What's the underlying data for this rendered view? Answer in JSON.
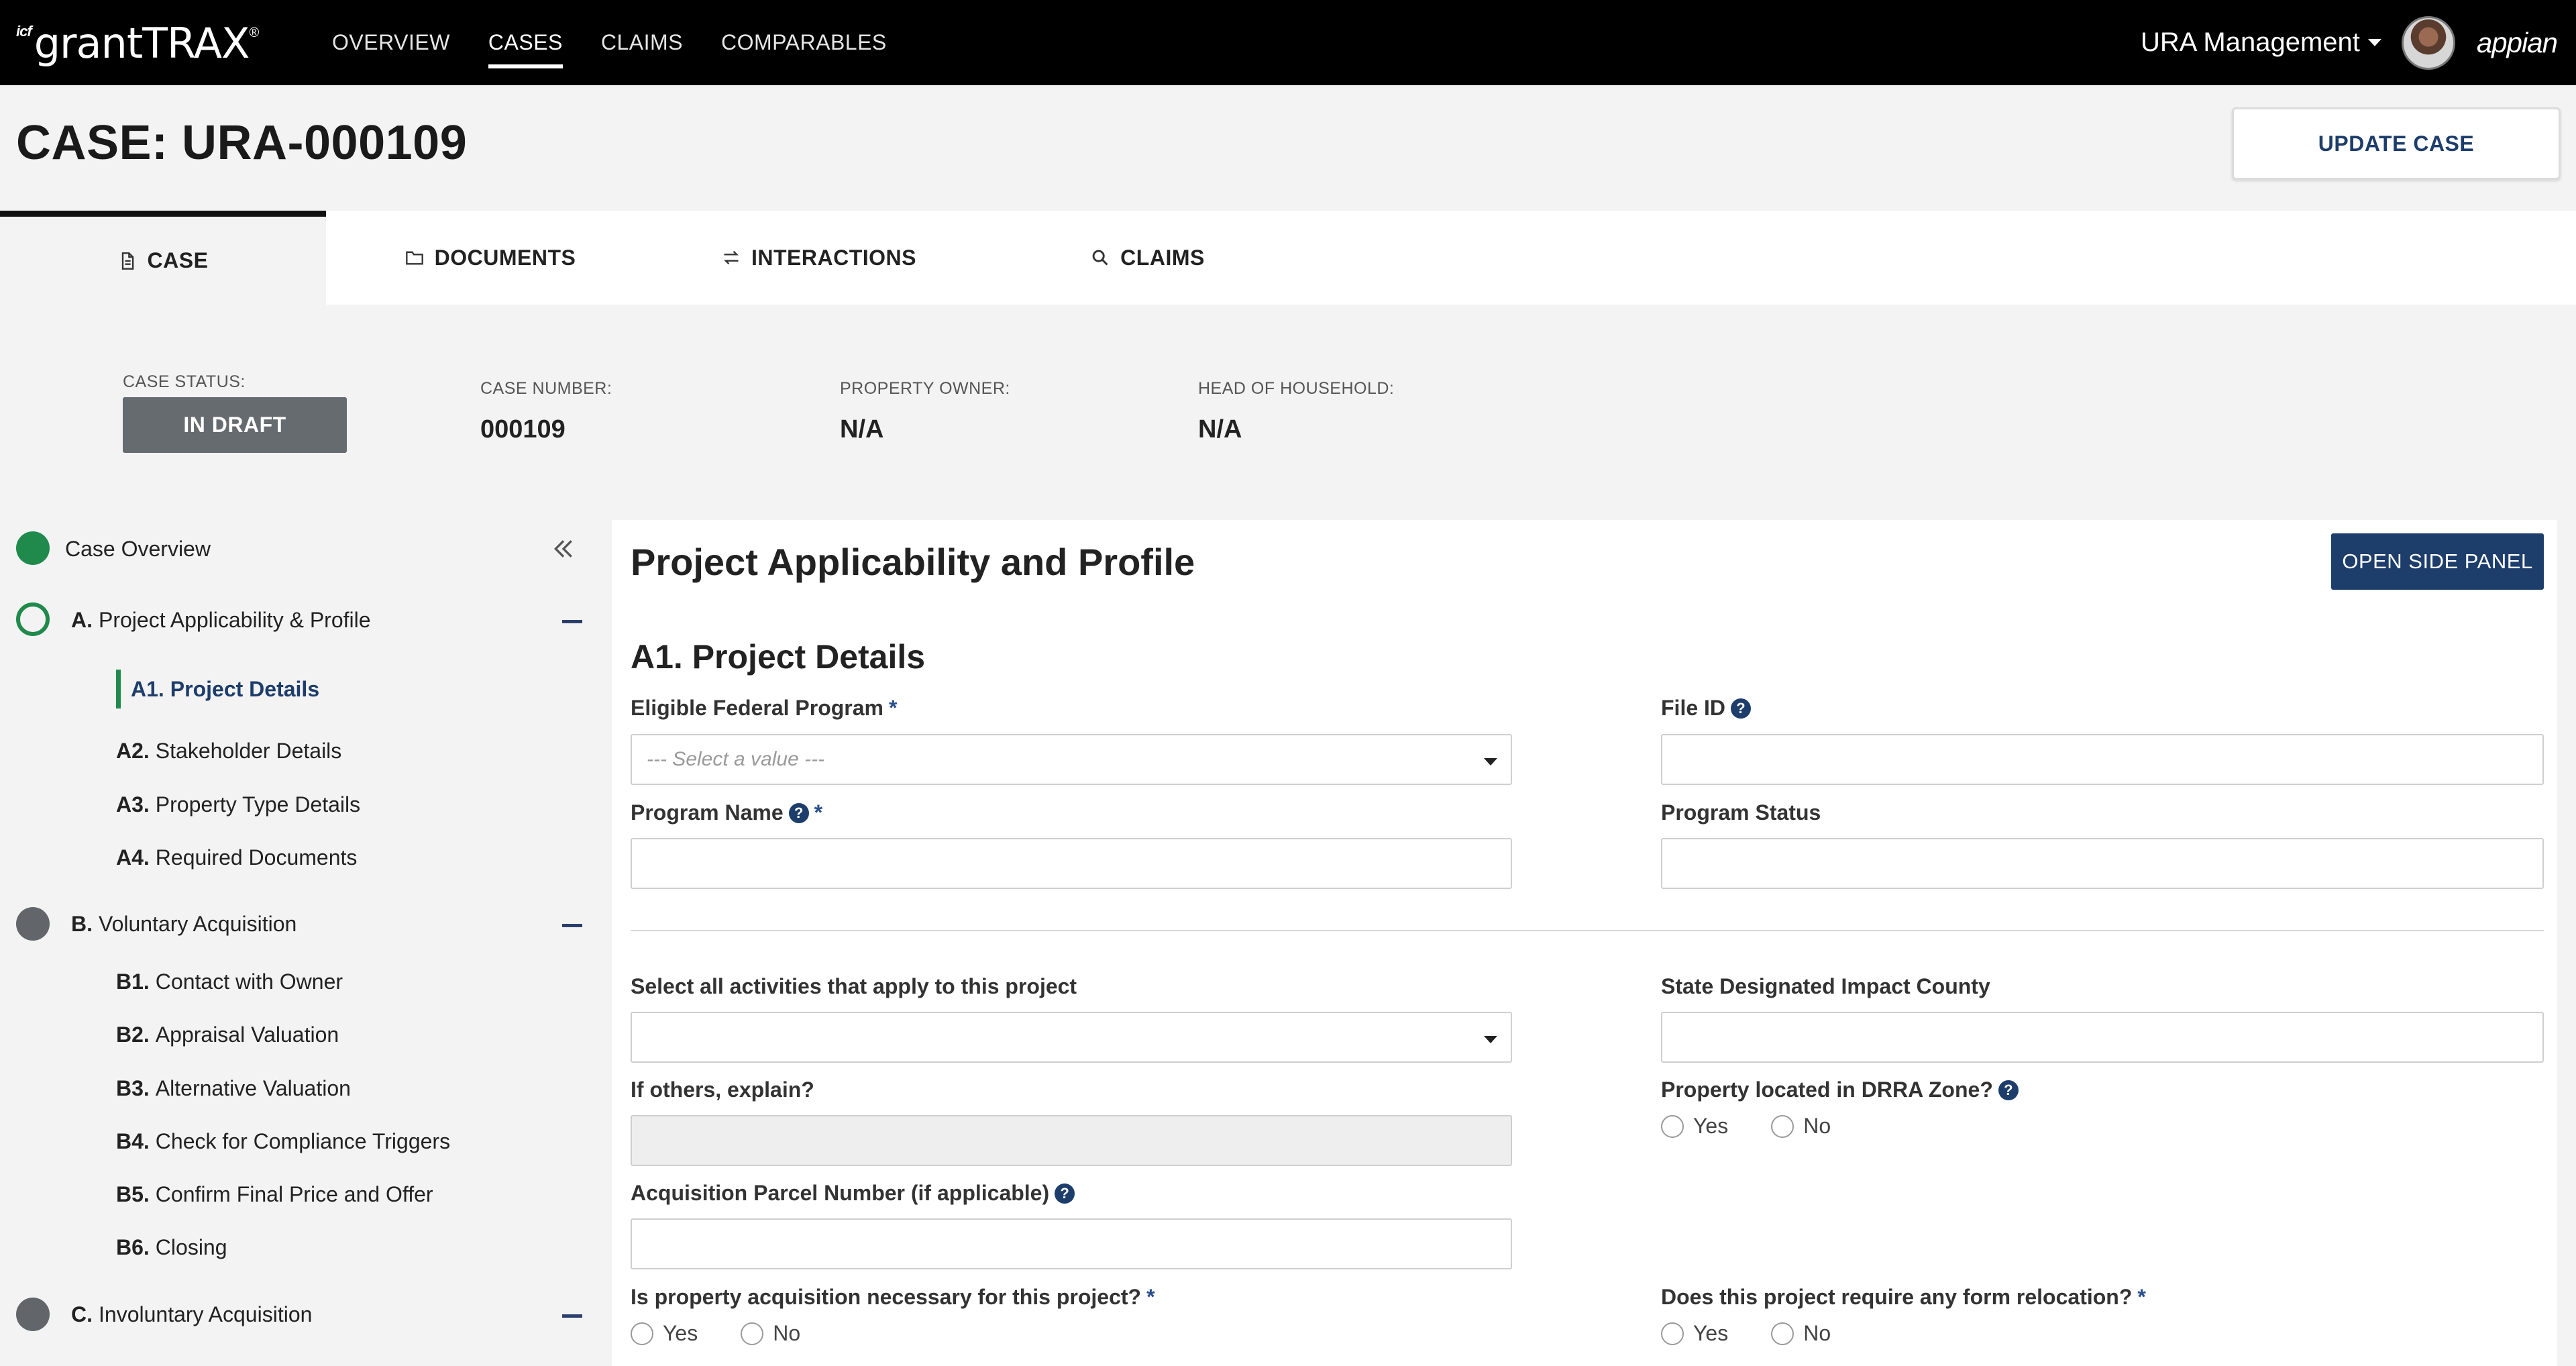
{
  "topbar": {
    "brand_prefix": "icf",
    "brand": "grantTRAX",
    "trademark": "®",
    "nav": [
      "OVERVIEW",
      "CASES",
      "CLAIMS",
      "COMPARABLES"
    ],
    "active_nav": "CASES",
    "user_menu": "URA Management",
    "platform": "appian"
  },
  "case": {
    "title": "CASE: URA-000109",
    "update_button": "UPDATE CASE"
  },
  "tabs": [
    {
      "label": "CASE",
      "icon": "document-icon"
    },
    {
      "label": "DOCUMENTS",
      "icon": "folder-icon"
    },
    {
      "label": "INTERACTIONS",
      "icon": "arrows-exchange-icon"
    },
    {
      "label": "CLAIMS",
      "icon": "search-icon"
    }
  ],
  "summary": {
    "status_label": "CASE STATUS:",
    "status_value": "IN DRAFT",
    "number_label": "CASE NUMBER:",
    "number_value": "000109",
    "owner_label": "PROPERTY OWNER:",
    "owner_value": "N/A",
    "head_label": "HEAD OF HOUSEHOLD:",
    "head_value": "N/A"
  },
  "sidebar": {
    "overview": "Case Overview",
    "section_a": {
      "code": "A.",
      "label": "Project Applicability & Profile"
    },
    "a_items": [
      {
        "code": "A1.",
        "label": "Project Details"
      },
      {
        "code": "A2.",
        "label": "Stakeholder Details"
      },
      {
        "code": "A3.",
        "label": "Property Type Details"
      },
      {
        "code": "A4.",
        "label": "Required Documents"
      }
    ],
    "section_b": {
      "code": "B.",
      "label": "Voluntary Acquisition"
    },
    "b_items": [
      {
        "code": "B1.",
        "label": "Contact with Owner"
      },
      {
        "code": "B2.",
        "label": "Appraisal Valuation"
      },
      {
        "code": "B3.",
        "label": "Alternative Valuation"
      },
      {
        "code": "B4.",
        "label": "Check for Compliance Triggers"
      },
      {
        "code": "B5.",
        "label": "Confirm Final Price and Offer"
      },
      {
        "code": "B6.",
        "label": "Closing"
      }
    ],
    "section_c": {
      "code": "C.",
      "label": "Involuntary Acquisition"
    },
    "colors": {
      "complete": "#1f8a4c",
      "pending": "#62666b",
      "active_text": "#1d3d6b"
    }
  },
  "form": {
    "panel_title": "Project Applicability and Profile",
    "side_panel_button": "OPEN SIDE PANEL",
    "section_title": "A1. Project Details",
    "eligible_program_label": "Eligible Federal Program",
    "eligible_program_placeholder": "--- Select a value ---",
    "file_id_label": "File ID",
    "program_name_label": "Program Name",
    "program_status_label": "Program Status",
    "activities_label": "Select all activities that apply to this project",
    "impact_county_label": "State Designated Impact County",
    "others_label": "If others, explain?",
    "drra_label": "Property located in DRRA Zone?",
    "parcel_label": "Acquisition Parcel Number (if applicable)",
    "acquisition_label": "Is property acquisition necessary for this project?",
    "relocation_label": "Does this project require any form relocation?",
    "required_mark": "*",
    "help_glyph": "?",
    "yes": "Yes",
    "no": "No"
  }
}
